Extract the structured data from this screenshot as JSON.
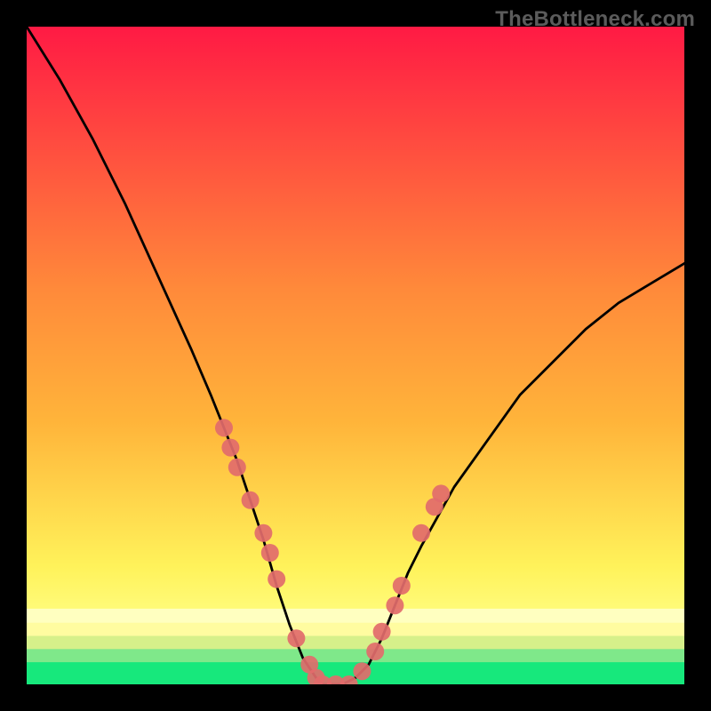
{
  "watermark": "TheBottleneck.com",
  "colors": {
    "frame": "#000000",
    "gradient_top": "#ff1a44",
    "gradient_mid_upper": "#ffb43a",
    "gradient_mid_lower": "#ffff88",
    "gradient_bottom": "#17e87c",
    "curve": "#000000",
    "marker_fill": "#e26b6b",
    "marker_stroke": "#c95a5a"
  },
  "chart_data": {
    "type": "line",
    "title": "",
    "xlabel": "",
    "ylabel": "",
    "xlim": [
      0,
      100
    ],
    "ylim": [
      0,
      100
    ],
    "series": [
      {
        "name": "bottleneck-curve",
        "x": [
          0,
          5,
          10,
          15,
          20,
          25,
          28,
          30,
          32,
          34,
          36,
          38,
          40,
          42,
          44,
          45,
          46,
          48,
          50,
          52,
          54,
          56,
          58,
          60,
          65,
          70,
          75,
          80,
          85,
          90,
          95,
          100
        ],
        "y": [
          100,
          92,
          83,
          73,
          62,
          51,
          44,
          39,
          34,
          28,
          22,
          15,
          9,
          4,
          1,
          0,
          0,
          0,
          1,
          3,
          7,
          12,
          17,
          21,
          30,
          37,
          44,
          49,
          54,
          58,
          61,
          64
        ]
      }
    ],
    "markers": [
      {
        "x": 30,
        "y": 39
      },
      {
        "x": 31,
        "y": 36
      },
      {
        "x": 32,
        "y": 33
      },
      {
        "x": 34,
        "y": 28
      },
      {
        "x": 36,
        "y": 23
      },
      {
        "x": 37,
        "y": 20
      },
      {
        "x": 38,
        "y": 16
      },
      {
        "x": 41,
        "y": 7
      },
      {
        "x": 43,
        "y": 3
      },
      {
        "x": 44,
        "y": 1
      },
      {
        "x": 45,
        "y": 0
      },
      {
        "x": 47,
        "y": 0
      },
      {
        "x": 49,
        "y": 0
      },
      {
        "x": 51,
        "y": 2
      },
      {
        "x": 53,
        "y": 5
      },
      {
        "x": 54,
        "y": 8
      },
      {
        "x": 56,
        "y": 12
      },
      {
        "x": 57,
        "y": 15
      },
      {
        "x": 60,
        "y": 23
      },
      {
        "x": 62,
        "y": 27
      },
      {
        "x": 63,
        "y": 29
      }
    ],
    "bands": [
      {
        "name": "good",
        "y_from": 0,
        "y_to": 4,
        "color": "#17e87c"
      },
      {
        "name": "med1",
        "y_from": 4,
        "y_to": 8,
        "color": "#c2f06e"
      },
      {
        "name": "med2",
        "y_from": 8,
        "y_to": 14,
        "color": "#ffff88"
      },
      {
        "name": "warn",
        "y_from": 14,
        "y_to": 55,
        "color": "gradient"
      },
      {
        "name": "bad",
        "y_from": 55,
        "y_to": 100,
        "color": "gradient"
      }
    ]
  }
}
